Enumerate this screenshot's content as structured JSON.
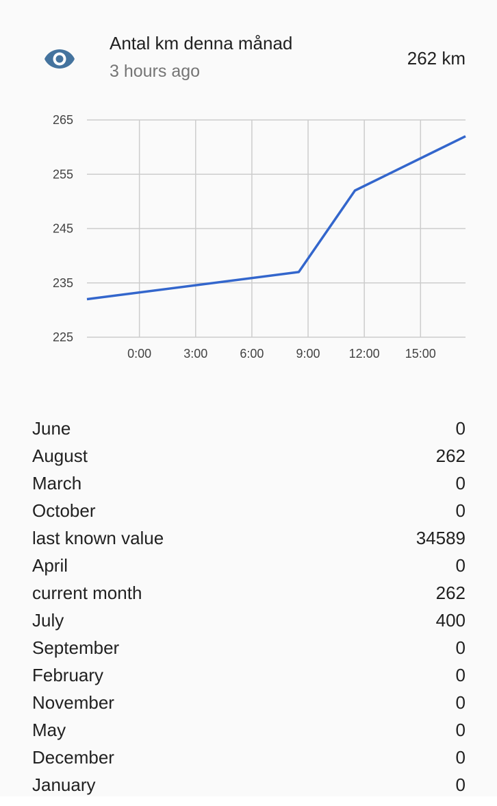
{
  "entity": {
    "name": "Antal km denna månad",
    "last_changed": "3 hours ago",
    "state": "262 km",
    "icon": "eye-icon"
  },
  "colors": {
    "icon": "#44739e",
    "line": "#3366cc",
    "grid": "#cccccc",
    "secondary_text": "#757575"
  },
  "chart_data": {
    "type": "line",
    "x_tick_labels": [
      "0:00",
      "3:00",
      "6:00",
      "9:00",
      "12:00",
      "15:00"
    ],
    "y_tick_labels": [
      "265",
      "255",
      "245",
      "235",
      "225"
    ],
    "ylim": [
      225,
      265
    ],
    "xlim_hours": [
      -2.8,
      17.4
    ],
    "grid": true,
    "series": [
      {
        "x_hours": [
          -2.8,
          8.5,
          11.5,
          17.4
        ],
        "values": [
          232,
          237,
          252,
          262
        ]
      }
    ]
  },
  "attributes": [
    {
      "key": "June",
      "value": "0"
    },
    {
      "key": "August",
      "value": "262"
    },
    {
      "key": "March",
      "value": "0"
    },
    {
      "key": "October",
      "value": "0"
    },
    {
      "key": "last known value",
      "value": "34589"
    },
    {
      "key": "April",
      "value": "0"
    },
    {
      "key": "current month",
      "value": "262"
    },
    {
      "key": "July",
      "value": "400"
    },
    {
      "key": "September",
      "value": "0"
    },
    {
      "key": "February",
      "value": "0"
    },
    {
      "key": "November",
      "value": "0"
    },
    {
      "key": "May",
      "value": "0"
    },
    {
      "key": "December",
      "value": "0"
    },
    {
      "key": "January",
      "value": "0"
    }
  ]
}
